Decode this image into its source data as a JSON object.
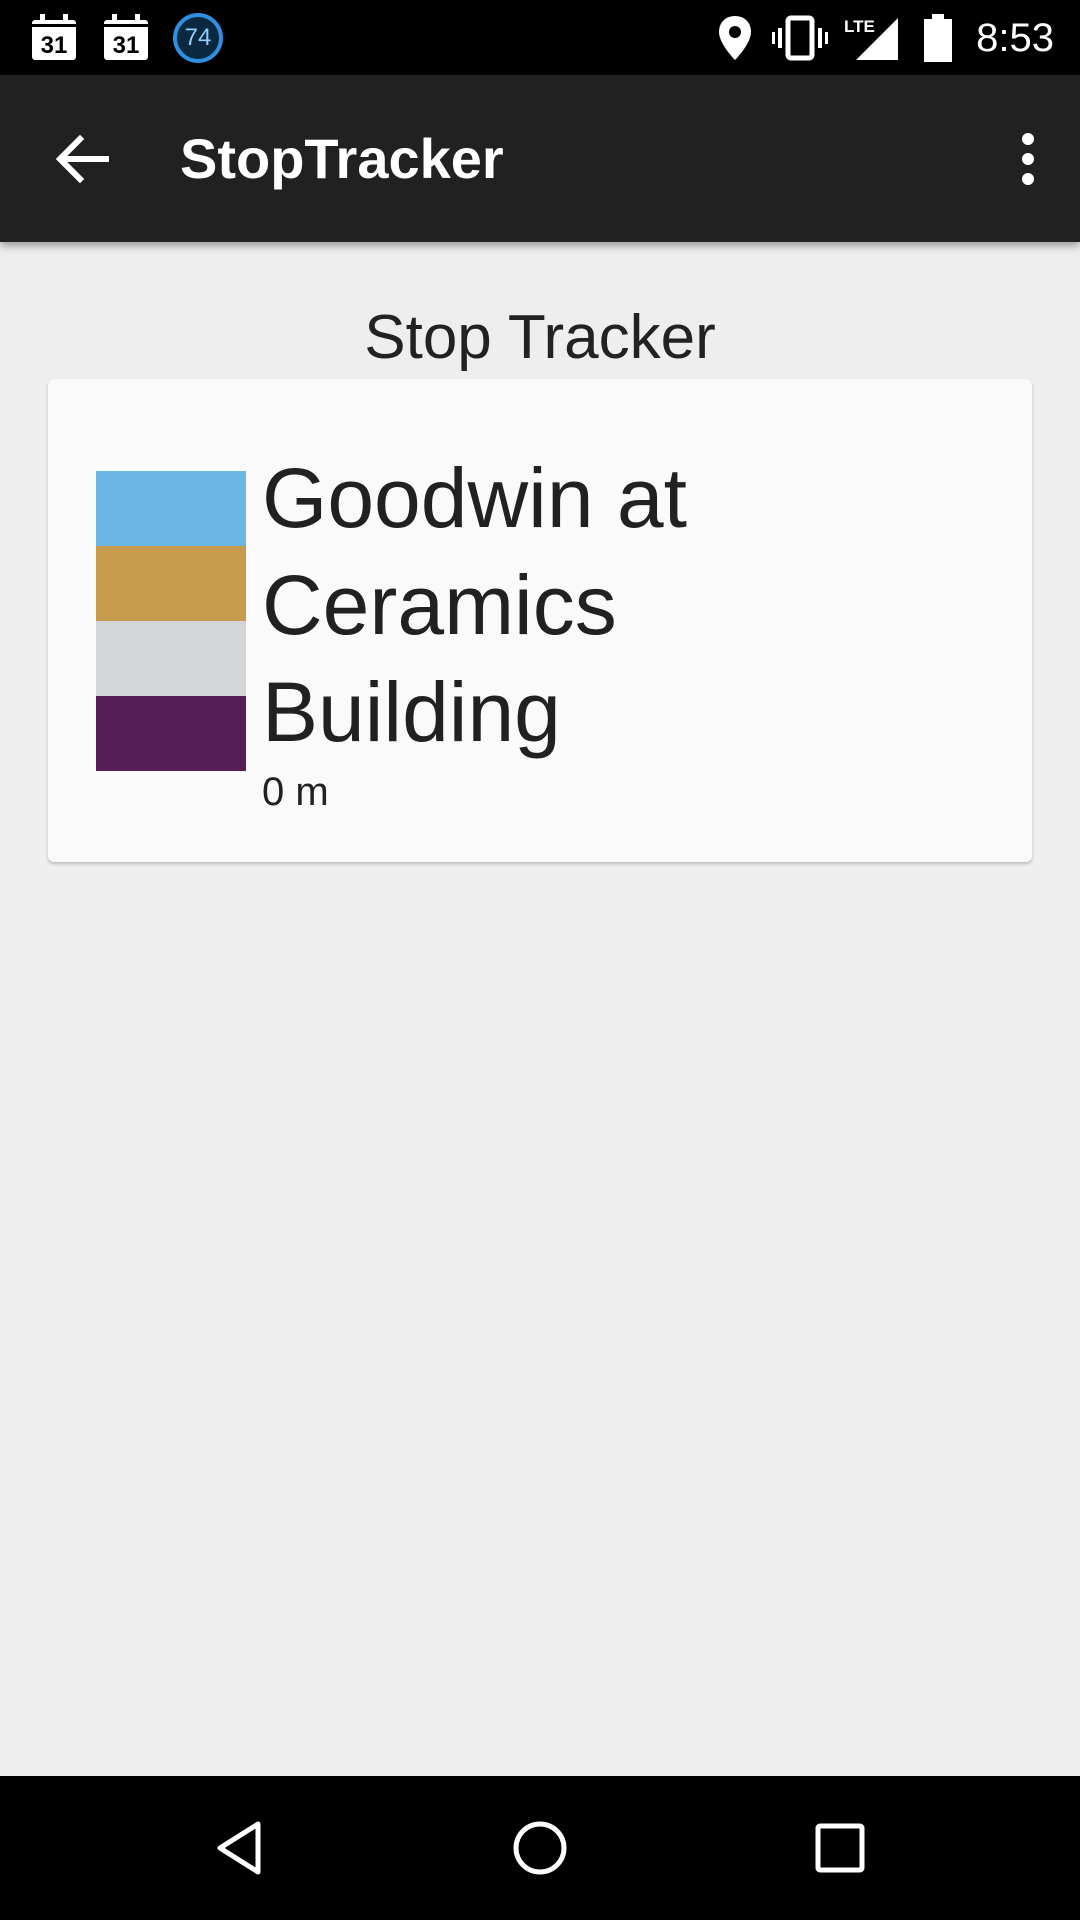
{
  "status_bar": {
    "calendar_1": "31",
    "calendar_2": "31",
    "badge": "74",
    "time": "8:53",
    "lte_label": "LTE",
    "icons": [
      "calendar-icon",
      "calendar-icon",
      "notification-badge-icon",
      "location-icon",
      "vibrate-icon",
      "lte-signal-icon",
      "battery-icon"
    ]
  },
  "app_bar": {
    "title": "StopTracker",
    "icons": [
      "back-arrow-icon",
      "more-vert-icon"
    ]
  },
  "main": {
    "heading": "Stop Tracker",
    "stops": [
      {
        "name": "Goodwin at Ceramics Building",
        "distance": "0 m",
        "route_colors": [
          "#6bb6e4",
          "#c89a4e",
          "#d4d5d7",
          "#561e57"
        ]
      }
    ]
  },
  "nav_bar": {
    "icons": [
      "back-triangle-icon",
      "home-circle-icon",
      "recents-square-icon"
    ]
  }
}
